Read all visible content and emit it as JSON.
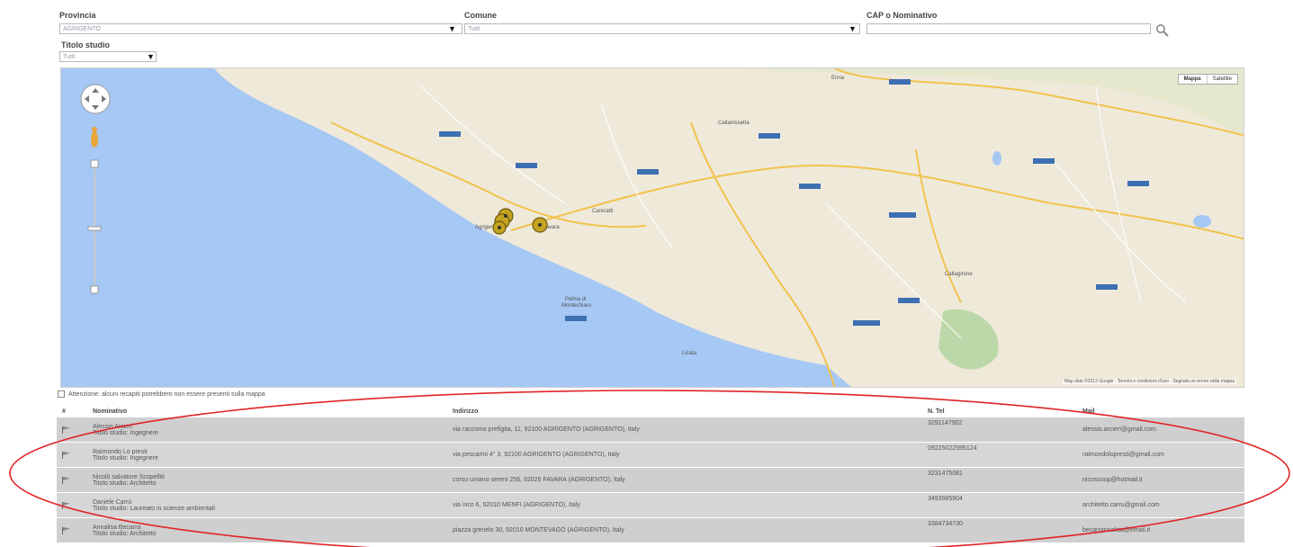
{
  "filters": {
    "provincia": {
      "label": "Provincia",
      "value": "AGRIGENTO"
    },
    "comune": {
      "label": "Comune",
      "placeholder": "Tutti"
    },
    "cap": {
      "label": "CAP o Nominativo",
      "placeholder": ""
    },
    "titolo": {
      "label": "Titolo studio",
      "placeholder": "Tutti"
    }
  },
  "map": {
    "type_buttons": [
      "Mappa",
      "Satellite"
    ],
    "footer": "Map data ©2013 Google · Termini e condizioni d'uso · Segnala un errore nella mappa",
    "places": [
      "Palma di Montechiaro",
      "Caltanissetta",
      "Caltagirone",
      "Licata",
      "Enna",
      "Canicattì",
      "Favara",
      "Agrigento"
    ],
    "colors": {
      "sea": "#a6c8f4",
      "land": "#efe9da",
      "road": "#f2c24c",
      "marker": "#c4a321"
    }
  },
  "notice": "Attenzione: alcuni recapiti potrebbero non essere presenti sulla mappa",
  "table": {
    "headers": [
      "#",
      "Nominativo",
      "Indirizzo",
      "N. Tel",
      "Mail"
    ],
    "rows": [
      {
        "name": "Alessio Arcieri",
        "title": "Titolo studio: Ingegnere",
        "address": "via raccomo prefigita, 11, 92100 AGRIGENTO (AGRIGENTO), Italy",
        "phone": "3291147902",
        "mail": "alessio.arcieri@gmail.com"
      },
      {
        "name": "Raimondo Lo presti",
        "title": "Titolo studio: Ingegnere",
        "address": "via pescarini 4° 3, 92100 AGRIGENTO (AGRIGENTO), Italy",
        "phone": "09225022595124",
        "mail": "raimondolopresti@gmail.com"
      },
      {
        "name": "Nicolò salvatore Scopelliti",
        "title": "Titolo studio: Architetto",
        "address": "corso umano sereni 256, 92026 FAVARA (AGRIGENTO), Italy",
        "phone": "3231475081",
        "mail": "nicoscoop@hotmail.it"
      },
      {
        "name": "Daniele Carrù",
        "title": "Titolo studio: Laureato in scienze ambientali",
        "address": "via inco 6, 92010 MENFI (AGRIGENTO), Italy",
        "phone": "3493985904",
        "mail": "architetto.carru@gmail.com"
      },
      {
        "name": "Annalisa Becarra",
        "title": "Titolo studio: Architetto",
        "address": "piazza grenelo 30, 92010 MONTEVAGO (AGRIGENTO), Italy",
        "phone": "3384734730",
        "mail": "becarrannalisa@email.it"
      }
    ]
  }
}
